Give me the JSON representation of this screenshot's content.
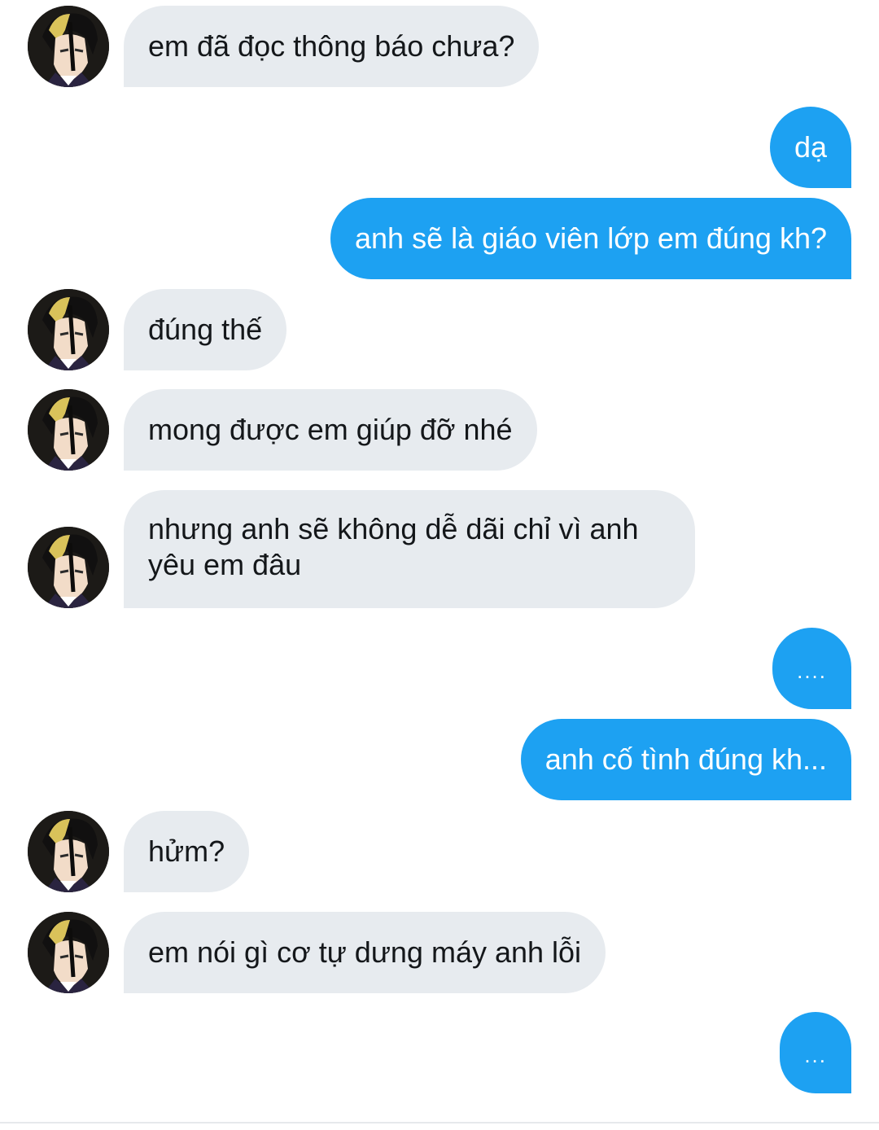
{
  "contact": {
    "avatar_icon": "anime-character-avatar-icon"
  },
  "colors": {
    "incoming_bubble": "#e7ebef",
    "outgoing_bubble": "#1da1f2",
    "incoming_text": "#14171a",
    "outgoing_text": "#ffffff"
  },
  "messages": [
    {
      "direction": "incoming",
      "text": "em đã đọc thông báo chưa?"
    },
    {
      "direction": "outgoing",
      "text": "dạ"
    },
    {
      "direction": "outgoing",
      "text": "anh sẽ là giáo viên lớp em đúng kh?"
    },
    {
      "direction": "incoming",
      "text": "đúng thế"
    },
    {
      "direction": "incoming",
      "text": "mong được em giúp đỡ nhé"
    },
    {
      "direction": "incoming",
      "text": "nhưng anh sẽ không dễ dãi chỉ vì anh yêu em đâu"
    },
    {
      "direction": "outgoing",
      "text": "...."
    },
    {
      "direction": "outgoing",
      "text": "anh cố tình đúng kh..."
    },
    {
      "direction": "incoming",
      "text": "hửm?"
    },
    {
      "direction": "incoming",
      "text": "em nói gì cơ tự dưng máy anh lỗi"
    },
    {
      "direction": "outgoing",
      "text": "..."
    }
  ]
}
